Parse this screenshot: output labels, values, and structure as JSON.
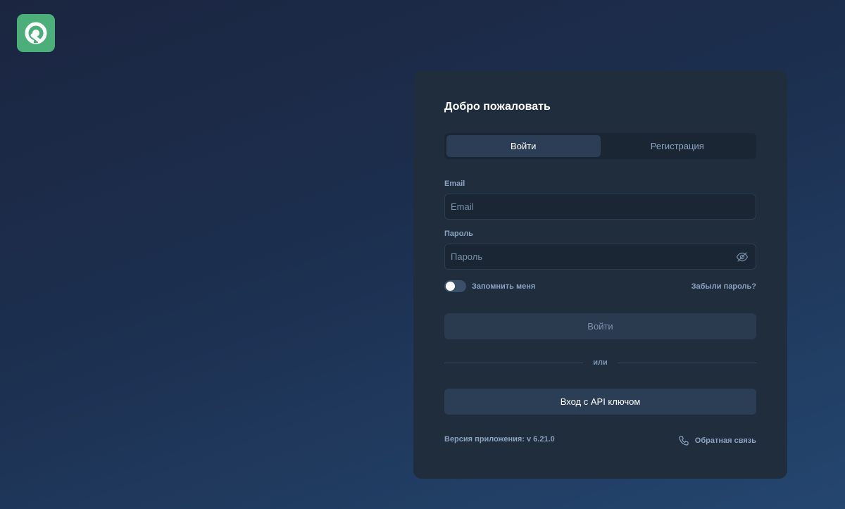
{
  "brand": {
    "logo_icon": "app-logo-icon",
    "accent_color": "#4caf7a"
  },
  "login_card": {
    "title": "Добро пожаловать",
    "tabs": [
      {
        "label": "Войти",
        "active": true
      },
      {
        "label": "Регистрация",
        "active": false
      }
    ],
    "email": {
      "label": "Email",
      "placeholder": "Email",
      "value": ""
    },
    "password": {
      "label": "Пароль",
      "placeholder": "Пароль",
      "value": "",
      "visibility_icon": "eye-off-icon"
    },
    "remember_me": {
      "label": "Запомнить меня",
      "checked": false
    },
    "forgot_password": "Забыли пароль?",
    "login_button": "Войти",
    "divider_text": "или",
    "api_key_button": "Вход с API ключом",
    "app_version": "Версия приложения: v 6.21.0",
    "feedback": {
      "label": "Обратная связь",
      "icon": "phone-icon"
    }
  }
}
